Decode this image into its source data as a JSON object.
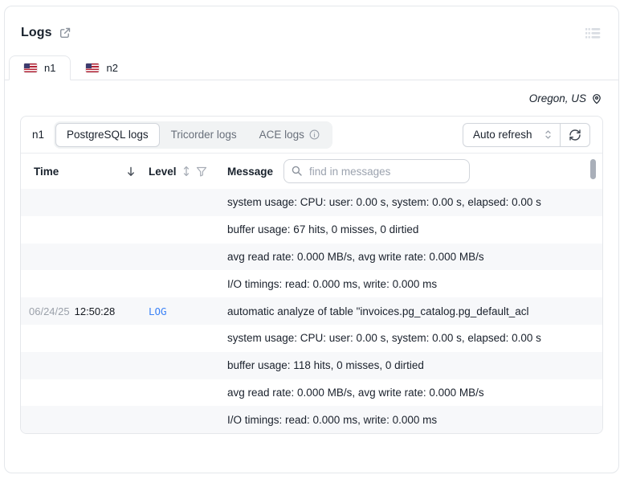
{
  "header": {
    "title": "Logs"
  },
  "tabs": [
    {
      "label": "n1",
      "flag": "us",
      "active": true
    },
    {
      "label": "n2",
      "flag": "us",
      "active": false
    }
  ],
  "region": {
    "label": "Oregon, US"
  },
  "toolbar": {
    "instance_label": "n1",
    "log_sources": [
      {
        "label": "PostgreSQL logs",
        "active": true
      },
      {
        "label": "Tricorder logs",
        "active": false
      },
      {
        "label": "ACE logs",
        "active": false,
        "has_info": true
      }
    ],
    "auto_refresh_label": "Auto refresh"
  },
  "table": {
    "columns": {
      "time": "Time",
      "level": "Level",
      "message": "Message"
    },
    "search_placeholder": "find in messages",
    "rows": [
      {
        "date": "",
        "time": "",
        "level": "",
        "message": "system usage: CPU: user: 0.00 s, system: 0.00 s, elapsed: 0.00 s"
      },
      {
        "date": "",
        "time": "",
        "level": "",
        "message": "buffer usage: 67 hits, 0 misses, 0 dirtied"
      },
      {
        "date": "",
        "time": "",
        "level": "",
        "message": "avg read rate: 0.000 MB/s, avg write rate: 0.000 MB/s"
      },
      {
        "date": "",
        "time": "",
        "level": "",
        "message": "I/O timings: read: 0.000 ms, write: 0.000 ms"
      },
      {
        "date": "06/24/25",
        "time": "12:50:28",
        "level": "LOG",
        "message": "automatic analyze of table \"invoices.pg_catalog.pg_default_acl"
      },
      {
        "date": "",
        "time": "",
        "level": "",
        "message": "system usage: CPU: user: 0.00 s, system: 0.00 s, elapsed: 0.00 s"
      },
      {
        "date": "",
        "time": "",
        "level": "",
        "message": "buffer usage: 118 hits, 0 misses, 0 dirtied"
      },
      {
        "date": "",
        "time": "",
        "level": "",
        "message": "avg read rate: 0.000 MB/s, avg write rate: 0.000 MB/s"
      },
      {
        "date": "",
        "time": "",
        "level": "",
        "message": "I/O timings: read: 0.000 ms, write: 0.000 ms"
      }
    ]
  },
  "colors": {
    "log_level_blue": "#3b82f6",
    "row_alt_background": "#f7f8fa",
    "border": "#e5e7eb"
  }
}
